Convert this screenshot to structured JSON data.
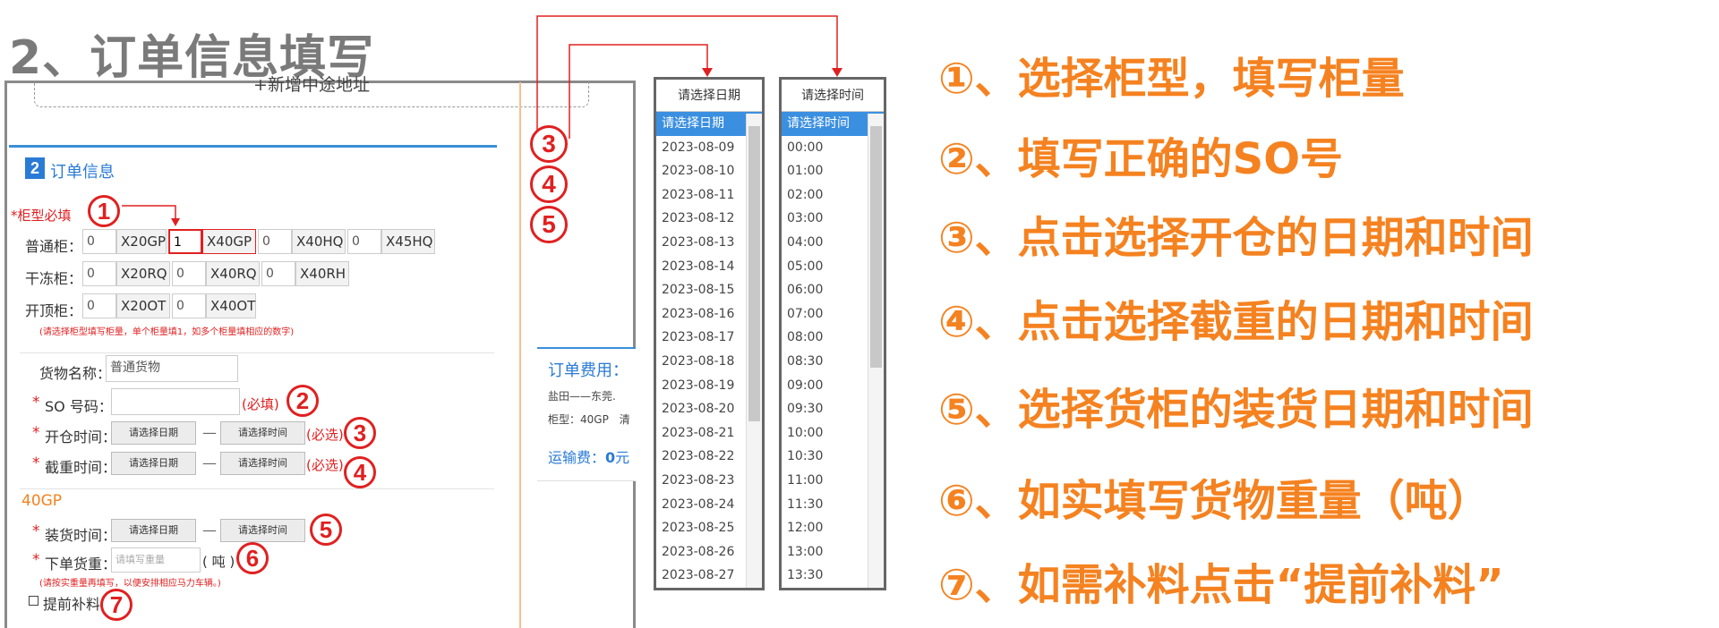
{
  "title": "2、订单信息填写",
  "form": {
    "add_address": "+新增中途地址",
    "section_title": "订单信息",
    "section_icon": "2",
    "container_required": "*柜型必填",
    "rows": {
      "normal": {
        "label": "普通柜：",
        "items": [
          {
            "qty": "0",
            "code": "X20GP"
          },
          {
            "qty": "1",
            "code": "X40GP"
          },
          {
            "qty": "0",
            "code": "X40HQ"
          },
          {
            "qty": "0",
            "code": "X45HQ"
          }
        ]
      },
      "reefer": {
        "label": "干冻柜：",
        "items": [
          {
            "qty": "0",
            "code": "X20RQ"
          },
          {
            "qty": "0",
            "code": "X40RQ"
          },
          {
            "qty": "0",
            "code": "X40RH"
          }
        ]
      },
      "opentop": {
        "label": "开顶柜：",
        "items": [
          {
            "qty": "0",
            "code": "X20OT"
          },
          {
            "qty": "0",
            "code": "X40OT"
          }
        ]
      }
    },
    "container_hint": "(请选择柜型填写柜量，单个柜量填1，如多个柜量填相应的数字)",
    "goods_label": "货物名称：",
    "goods_value": "普通货物",
    "so_label": "SO 号码：",
    "so_required": "(必填)",
    "open_label": "开仓时间：",
    "cutoff_label": "截重时间：",
    "optional": "(必选)",
    "select_date": "请选择日期",
    "select_time": "请选择时间",
    "dash": "—",
    "container_type": "40GP",
    "loading_label": "装货时间：",
    "weight_label": "下单货重：",
    "weight_placeholder": "请填写重量",
    "weight_unit": "( 吨 )",
    "weight_hint": "(请按实重量再填写，以便安排相应马力车辆。)",
    "advance_label": "提前补料"
  },
  "fee": {
    "title": "订单费用：",
    "route": "盐田——东莞.",
    "type": "柜型：40GP　清",
    "freight_label": "运输费：",
    "freight_value": "0",
    "freight_unit": "元"
  },
  "date_dropdown": {
    "header": "请选择日期",
    "items": [
      "请选择日期",
      "2023-08-09",
      "2023-08-10",
      "2023-08-11",
      "2023-08-12",
      "2023-08-13",
      "2023-08-14",
      "2023-08-15",
      "2023-08-16",
      "2023-08-17",
      "2023-08-18",
      "2023-08-19",
      "2023-08-20",
      "2023-08-21",
      "2023-08-22",
      "2023-08-23",
      "2023-08-24",
      "2023-08-25",
      "2023-08-26",
      "2023-08-27"
    ]
  },
  "time_dropdown": {
    "header": "请选择时间",
    "items": [
      "请选择时间",
      "00:00",
      "01:00",
      "02:00",
      "03:00",
      "04:00",
      "05:00",
      "06:00",
      "07:00",
      "08:00",
      "08:30",
      "09:00",
      "09:30",
      "10:00",
      "10:30",
      "11:00",
      "11:30",
      "12:00",
      "13:00",
      "13:30"
    ]
  },
  "markers": [
    "1",
    "2",
    "3",
    "4",
    "5",
    "6",
    "7"
  ],
  "instructions": [
    "①、选择柜型，填写柜量",
    "②、填写正确的SO号",
    "③、点击选择开仓的日期和时间",
    "④、点击选择截重的日期和时间",
    "⑤、选择货柜的装货日期和时间",
    "⑥、如实填写货物重量（吨）",
    "⑦、如需补料点击“提前补料”"
  ],
  "colors": {
    "accent_blue": "#3a8fd8",
    "instruction_orange": "#f58220",
    "marker_red": "#e02020",
    "title_gray": "#7a7a7a"
  }
}
